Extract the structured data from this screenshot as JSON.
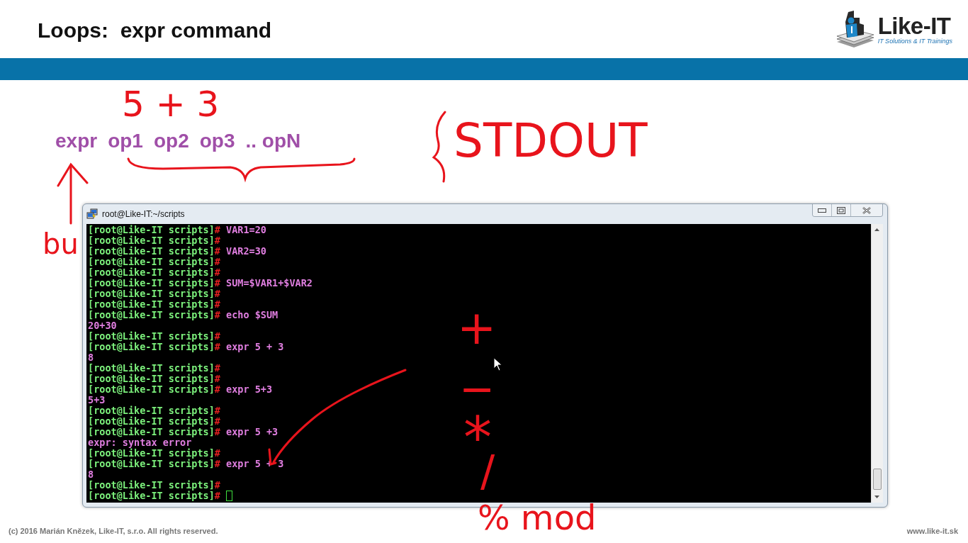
{
  "slide": {
    "title": "Loops:  expr command",
    "logo": {
      "name": "Like-IT",
      "tagline": "IT Solutions & IT Trainings"
    }
  },
  "syntax": [
    "expr",
    "op1",
    "op2",
    "op3",
    ".. opN"
  ],
  "terminal": {
    "title": "root@Like-IT:~/scripts",
    "lines": [
      {
        "kind": "prompt",
        "prompt": "[root@Like-IT scripts]",
        "sign": "#",
        "command": "VAR1=20",
        "cursor": false
      },
      {
        "kind": "prompt",
        "prompt": "[root@Like-IT scripts]",
        "sign": "#",
        "cursor": false
      },
      {
        "kind": "prompt",
        "prompt": "[root@Like-IT scripts]",
        "sign": "#",
        "command": "VAR2=30",
        "cursor": false
      },
      {
        "kind": "prompt",
        "prompt": "[root@Like-IT scripts]",
        "sign": "#",
        "cursor": false
      },
      {
        "kind": "prompt",
        "prompt": "[root@Like-IT scripts]",
        "sign": "#",
        "cursor": false
      },
      {
        "kind": "prompt",
        "prompt": "[root@Like-IT scripts]",
        "sign": "#",
        "command": "SUM=$VAR1+$VAR2",
        "cursor": false
      },
      {
        "kind": "prompt",
        "prompt": "[root@Like-IT scripts]",
        "sign": "#",
        "cursor": false
      },
      {
        "kind": "prompt",
        "prompt": "[root@Like-IT scripts]",
        "sign": "#",
        "cursor": false
      },
      {
        "kind": "prompt",
        "prompt": "[root@Like-IT scripts]",
        "sign": "#",
        "command": "echo $SUM",
        "cursor": false
      },
      {
        "kind": "output",
        "text": "20+30"
      },
      {
        "kind": "prompt",
        "prompt": "[root@Like-IT scripts]",
        "sign": "#",
        "cursor": false
      },
      {
        "kind": "prompt",
        "prompt": "[root@Like-IT scripts]",
        "sign": "#",
        "command": "expr 5 + 3",
        "cursor": false
      },
      {
        "kind": "output",
        "text": "8"
      },
      {
        "kind": "prompt",
        "prompt": "[root@Like-IT scripts]",
        "sign": "#",
        "cursor": false
      },
      {
        "kind": "prompt",
        "prompt": "[root@Like-IT scripts]",
        "sign": "#",
        "cursor": false
      },
      {
        "kind": "prompt",
        "prompt": "[root@Like-IT scripts]",
        "sign": "#",
        "command": "expr 5+3",
        "cursor": false
      },
      {
        "kind": "output",
        "text": "5+3"
      },
      {
        "kind": "prompt",
        "prompt": "[root@Like-IT scripts]",
        "sign": "#",
        "cursor": false
      },
      {
        "kind": "prompt",
        "prompt": "[root@Like-IT scripts]",
        "sign": "#",
        "cursor": false
      },
      {
        "kind": "prompt",
        "prompt": "[root@Like-IT scripts]",
        "sign": "#",
        "command": "expr 5 +3",
        "cursor": false
      },
      {
        "kind": "output",
        "text": "expr: syntax error"
      },
      {
        "kind": "prompt",
        "prompt": "[root@Like-IT scripts]",
        "sign": "#",
        "cursor": false
      },
      {
        "kind": "prompt",
        "prompt": "[root@Like-IT scripts]",
        "sign": "#",
        "command": "expr 5 + 3",
        "cursor": false
      },
      {
        "kind": "output",
        "text": "8"
      },
      {
        "kind": "prompt",
        "prompt": "[root@Like-IT scripts]",
        "sign": "#",
        "cursor": false
      },
      {
        "kind": "prompt",
        "prompt": "[root@Like-IT scripts]",
        "sign": "#",
        "cursor": true
      }
    ]
  },
  "ink_notes": [
    {
      "text": "5 + 3"
    },
    {
      "text": "STDOUT"
    },
    {
      "text": "bu"
    },
    {
      "text": "+"
    },
    {
      "text": "−"
    },
    {
      "text": "*"
    },
    {
      "text": "/"
    },
    {
      "text": "% mod"
    }
  ],
  "footer": {
    "copyright": "(c) 2016 Marián Knězek, Like-IT, s.r.o. All rights reserved.",
    "website": "www.like-it.sk"
  }
}
